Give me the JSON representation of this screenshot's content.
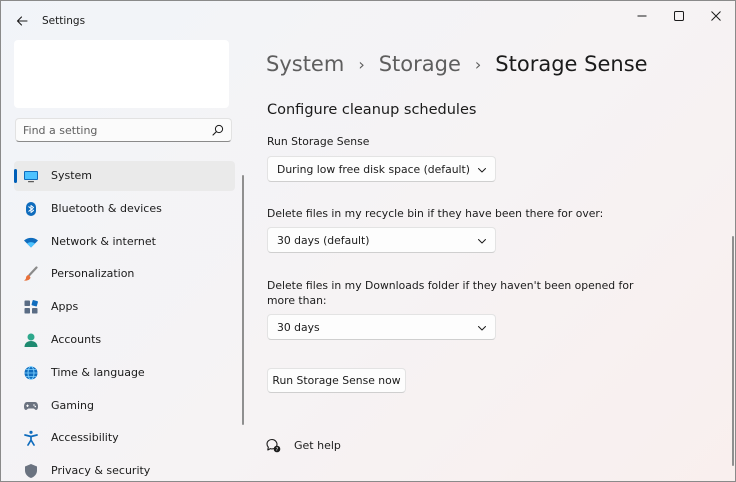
{
  "window": {
    "title": "Settings",
    "colors": {
      "accent": "#005fb8",
      "text": "#1b1b1b",
      "muted": "#5e5e5e"
    }
  },
  "search": {
    "placeholder": "Find a setting"
  },
  "sidebar": {
    "items": [
      {
        "label": "System",
        "icon": "system-icon",
        "selected": true
      },
      {
        "label": "Bluetooth & devices",
        "icon": "bluetooth-icon"
      },
      {
        "label": "Network & internet",
        "icon": "wifi-icon"
      },
      {
        "label": "Personalization",
        "icon": "brush-icon"
      },
      {
        "label": "Apps",
        "icon": "apps-icon"
      },
      {
        "label": "Accounts",
        "icon": "accounts-icon"
      },
      {
        "label": "Time & language",
        "icon": "globe-icon"
      },
      {
        "label": "Gaming",
        "icon": "gamepad-icon"
      },
      {
        "label": "Accessibility",
        "icon": "accessibility-icon"
      },
      {
        "label": "Privacy & security",
        "icon": "shield-icon"
      }
    ]
  },
  "breadcrumb": [
    "System",
    "Storage",
    "Storage Sense"
  ],
  "content": {
    "section_title": "Configure cleanup schedules",
    "run_label": "Run Storage Sense",
    "run_value": "During low free disk space (default)",
    "recycle_label": "Delete files in my recycle bin if they have been there for over:",
    "recycle_value": "30 days (default)",
    "downloads_label_line1": "Delete files in my Downloads folder if they haven't been opened for",
    "downloads_label_line2": "more than:",
    "downloads_value": "30 days",
    "run_now_button": "Run Storage Sense now",
    "help_label": "Get help"
  }
}
